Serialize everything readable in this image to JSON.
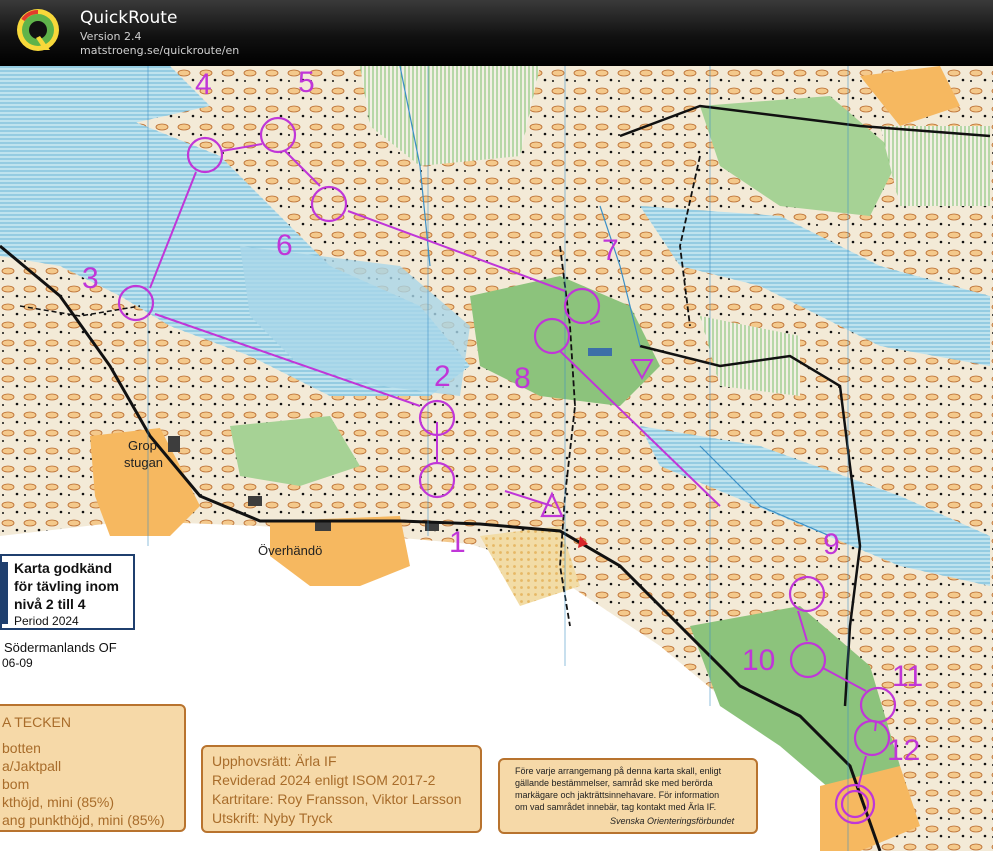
{
  "app": {
    "title": "QuickRoute",
    "version": "Version 2.4",
    "url": "matstroeng.se/quickroute/en"
  },
  "map": {
    "controls": [
      "1",
      "2",
      "3",
      "4",
      "5",
      "6",
      "7",
      "8",
      "9",
      "10",
      "11",
      "12"
    ],
    "places": {
      "gropstugan_line1": "Grop",
      "gropstugan_line2": "stugan",
      "overhando": "Överhändö"
    },
    "approval": {
      "line1": "Karta godkänd",
      "line2": "för tävling inom",
      "line3": "nivå 2 till 4",
      "period": "Period 2024"
    },
    "club": "Södermanlands OF",
    "date_fragment": "06-09",
    "legend": {
      "heading": "A TECKEN",
      "items": [
        "botten",
        "a/Jaktpall",
        "bom",
        "kthöjd, mini (85%)",
        "ang punkthöjd, mini (85%)"
      ]
    },
    "credits": {
      "copyright": "Upphovsrätt: Ärla IF",
      "revised": "Reviderad 2024 enligt ISOM 2017-2",
      "cartographers": "Kartritare: Roy Fransson, Viktor Larsson",
      "print": "Utskrift: Nyby Tryck"
    },
    "notice": {
      "lines": [
        "Före varje arrangemang på denna karta skall, enligt",
        "gällande bestämmelser, samråd ske med berörda",
        "markägare och jakträttsinnehavare. För information",
        "om vad samrådet innebär, tag kontakt med Ärla IF."
      ],
      "signature": "Svenska Orienteringsförbundet"
    },
    "colors": {
      "course": "#c036d8",
      "water": "#9fd3e6",
      "forest": "#8cc37c",
      "open": "#f6b860",
      "contour": "#b8692c"
    }
  }
}
